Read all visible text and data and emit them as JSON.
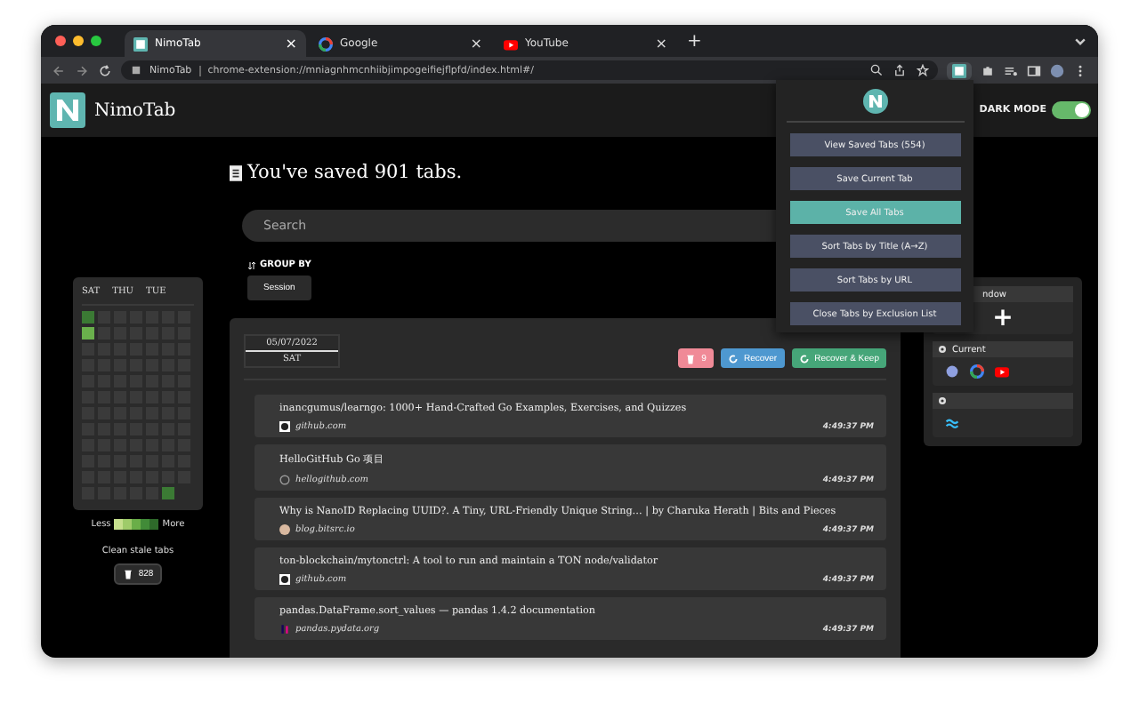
{
  "browser": {
    "tabs": [
      {
        "label": "NimoTab",
        "kind": "nimo",
        "close": "×",
        "selected": true
      },
      {
        "label": "Google",
        "kind": "google",
        "close": "×",
        "selected": false
      },
      {
        "label": "YouTube",
        "kind": "youtube",
        "close": "×",
        "selected": false
      }
    ],
    "new_tab": "+",
    "site_label": "NimoTab",
    "url": "chrome-extension://mniagnhmcnhiibjimpogeifiejflpfd/index.html#/"
  },
  "header": {
    "app_name": "NimoTab",
    "dark_mode_label": "DARK MODE",
    "dark_mode": true
  },
  "heading": "You've saved 901 tabs.",
  "search": {
    "placeholder": "Search"
  },
  "group_by": {
    "label": "GROUP BY",
    "value": "Session"
  },
  "heatmap": {
    "days": [
      "SAT",
      "THU",
      "TUE"
    ],
    "rows": [
      [
        {
          "kind": "dark"
        },
        {
          "kind": "empty"
        },
        {
          "kind": "empty"
        },
        {
          "kind": "empty"
        },
        {
          "kind": "empty"
        },
        {
          "kind": "empty"
        },
        {
          "kind": "empty"
        }
      ],
      [
        {
          "kind": "light"
        },
        {
          "kind": "empty"
        },
        {
          "kind": "empty"
        },
        {
          "kind": "empty"
        },
        {
          "kind": "empty"
        },
        {
          "kind": "empty"
        },
        {
          "kind": "empty"
        }
      ],
      [
        {
          "kind": "empty"
        },
        {
          "kind": "empty"
        },
        {
          "kind": "empty"
        },
        {
          "kind": "empty"
        },
        {
          "kind": "empty"
        },
        {
          "kind": "empty"
        },
        {
          "kind": "empty"
        }
      ],
      [
        {
          "kind": "empty"
        },
        {
          "kind": "empty"
        },
        {
          "kind": "empty"
        },
        {
          "kind": "empty"
        },
        {
          "kind": "empty"
        },
        {
          "kind": "empty"
        },
        {
          "kind": "empty"
        }
      ],
      [
        {
          "kind": "empty"
        },
        {
          "kind": "empty"
        },
        {
          "kind": "empty"
        },
        {
          "kind": "empty"
        },
        {
          "kind": "empty"
        },
        {
          "kind": "empty"
        },
        {
          "kind": "empty"
        }
      ],
      [
        {
          "kind": "empty"
        },
        {
          "kind": "empty"
        },
        {
          "kind": "empty"
        },
        {
          "kind": "empty"
        },
        {
          "kind": "empty"
        },
        {
          "kind": "empty"
        },
        {
          "kind": "empty"
        }
      ],
      [
        {
          "kind": "empty"
        },
        {
          "kind": "empty"
        },
        {
          "kind": "empty"
        },
        {
          "kind": "empty"
        },
        {
          "kind": "empty"
        },
        {
          "kind": "empty"
        },
        {
          "kind": "empty"
        }
      ],
      [
        {
          "kind": "empty"
        },
        {
          "kind": "empty"
        },
        {
          "kind": "empty"
        },
        {
          "kind": "empty"
        },
        {
          "kind": "empty"
        },
        {
          "kind": "empty"
        },
        {
          "kind": "empty"
        }
      ],
      [
        {
          "kind": "empty"
        },
        {
          "kind": "empty"
        },
        {
          "kind": "empty"
        },
        {
          "kind": "empty"
        },
        {
          "kind": "empty"
        },
        {
          "kind": "empty"
        },
        {
          "kind": "empty"
        }
      ],
      [
        {
          "kind": "empty"
        },
        {
          "kind": "empty"
        },
        {
          "kind": "empty"
        },
        {
          "kind": "empty"
        },
        {
          "kind": "empty"
        },
        {
          "kind": "empty"
        },
        {
          "kind": "empty"
        }
      ],
      [
        {
          "kind": "empty"
        },
        {
          "kind": "empty"
        },
        {
          "kind": "empty"
        },
        {
          "kind": "empty"
        },
        {
          "kind": "empty"
        },
        {
          "kind": "empty"
        },
        {
          "kind": "empty"
        }
      ],
      [
        {
          "kind": "empty"
        },
        {
          "kind": "empty"
        },
        {
          "kind": "empty"
        },
        {
          "kind": "empty"
        },
        {
          "kind": "empty"
        },
        {
          "kind": "dark"
        }
      ]
    ],
    "less": "Less",
    "more": "More"
  },
  "clean": {
    "label": "Clean stale tabs",
    "count": "828"
  },
  "session": {
    "date": "05/07/2022",
    "day": "SAT",
    "delete_count": "9",
    "recover": "Recover",
    "recover_keep": "Recover & Keep",
    "items": [
      {
        "title": "inancgumus/learngo: 1000+ Hand-Crafted Go Examples, Exercises, and Quizzes",
        "kind": "github",
        "domain": "github.com",
        "time": "4:49:37 PM"
      },
      {
        "title": "HelloGitHub Go 项目",
        "kind": "hellogithub",
        "domain": "hellogithub.com",
        "time": "4:49:37 PM"
      },
      {
        "title": "Why is NanoID Replacing UUID?. A Tiny, URL-Friendly Unique String… | by Charuka Herath | Bits and Pieces",
        "kind": "avatar",
        "domain": "blog.bitsrc.io",
        "time": "4:49:37 PM"
      },
      {
        "title": "ton-blockchain/mytonctrl: A tool to run and maintain a TON node/validator",
        "kind": "github",
        "domain": "github.com",
        "time": "4:49:37 PM"
      },
      {
        "title": "pandas.DataFrame.sort_values — pandas 1.4.2 documentation",
        "kind": "pandas",
        "domain": "pandas.pydata.org",
        "time": "4:49:37 PM"
      }
    ]
  },
  "windows": [
    {
      "title": "ndow",
      "kind": "new",
      "plus": "+"
    },
    {
      "title": "Current",
      "kind": "list",
      "icons": [
        {
          "kind": "globe"
        },
        {
          "kind": "google"
        },
        {
          "kind": "youtube"
        }
      ]
    },
    {
      "kind": "list",
      "icons": [
        {
          "kind": "waves"
        }
      ]
    }
  ],
  "popup": {
    "buttons": [
      {
        "label": "View Saved Tabs (554)",
        "selected": false
      },
      {
        "label": "Save Current Tab",
        "selected": false
      },
      {
        "label": "Save All Tabs",
        "selected": true
      },
      {
        "label": "Sort Tabs by Title (A→Z)",
        "selected": false
      },
      {
        "label": "Sort Tabs by URL",
        "selected": false
      },
      {
        "label": "Close Tabs by Exclusion List",
        "selected": false
      }
    ]
  }
}
